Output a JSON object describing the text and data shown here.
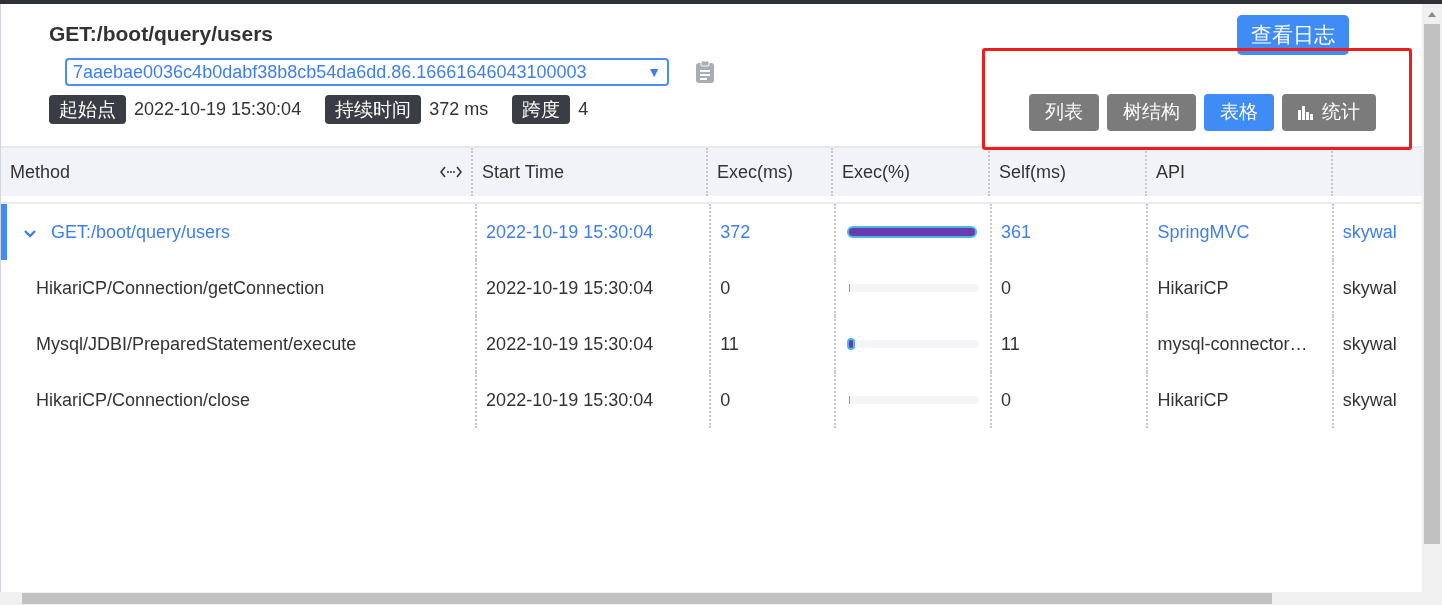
{
  "trace": {
    "title": "GET:/boot/query/users",
    "trace_id": "7aaebae0036c4b0dabf38b8cb54da6dd.86.16661646043100003",
    "dropdown_arrow": "▼",
    "stats": [
      {
        "label": "起始点",
        "value": "2022-10-19 15:30:04"
      },
      {
        "label": "持续时间",
        "value": "372 ms"
      },
      {
        "label": "跨度",
        "value": "4"
      }
    ]
  },
  "log_button": "查看日志",
  "view_tabs": [
    {
      "label": "列表",
      "kind": "plain",
      "selected": false
    },
    {
      "label": "树结构",
      "kind": "plain",
      "selected": false
    },
    {
      "label": "表格",
      "kind": "plain",
      "selected": true
    },
    {
      "label": "统计",
      "kind": "chart",
      "selected": false
    }
  ],
  "table": {
    "columns": [
      "Method",
      "Start Time",
      "Exec(ms)",
      "Exec(%)",
      "Self(ms)",
      "API"
    ],
    "rows": [
      {
        "method": "GET:/boot/query/users",
        "start_time": "2022-10-19 15:30:04",
        "exec_ms": "372",
        "level": 0.97,
        "self_ms": "361",
        "api": "SpringMVC",
        "column_7": "skywal",
        "selected": true,
        "expanded": true,
        "children": [
          {
            "method": "HikariCP/Connection/getConnection",
            "start_time": "2022-10-19 15:30:04",
            "exec_ms": "0",
            "level": 0,
            "self_ms": "0",
            "api": "HikariCP",
            "column_7": "skywal",
            "selected": false
          },
          {
            "method": "Mysql/JDBI/PreparedStatement/execute",
            "start_time": "2022-10-19 15:30:04",
            "exec_ms": "11",
            "level": 0.03,
            "self_ms": "11",
            "api": "mysql-connector…",
            "column_7": "skywal",
            "selected": false
          },
          {
            "method": "HikariCP/Connection/close",
            "start_time": "2022-10-19 15:30:04",
            "exec_ms": "0",
            "level": 0,
            "self_ms": "0",
            "api": "HikariCP",
            "column_7": "skywal",
            "selected": false
          }
        ]
      }
    ]
  }
}
